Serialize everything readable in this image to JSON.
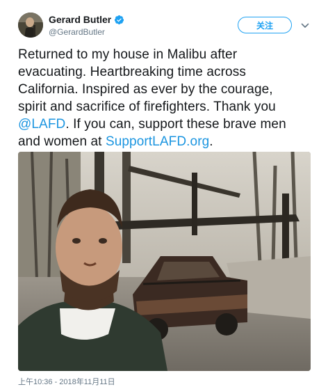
{
  "user": {
    "display_name": "Gerard Butler",
    "handle": "@GerardButler",
    "verified": true
  },
  "follow_button": {
    "label": "关注",
    "color": "#1da1f2"
  },
  "menu": {
    "icon": "chevron-down-icon"
  },
  "tweet": {
    "lines": [
      "Returned to my house in Malibu after",
      "evacuating. Heartbreaking time across",
      "California. Inspired as ever by the courage,",
      "spirit and sacrifice of firefighters. Thank you"
    ],
    "line5_mention": "@LAFD",
    "line5_rest": ". If you can, support these brave men",
    "line6_pre": "and women at ",
    "line6_link": "SupportLAFD.org",
    "line6_post": ".",
    "link_color": "#1b95e0"
  },
  "photo": {
    "subject": "selfie in front of a burned-out truck and house ruins"
  },
  "timestamp": "上午10:36 - 2018年11月11日"
}
